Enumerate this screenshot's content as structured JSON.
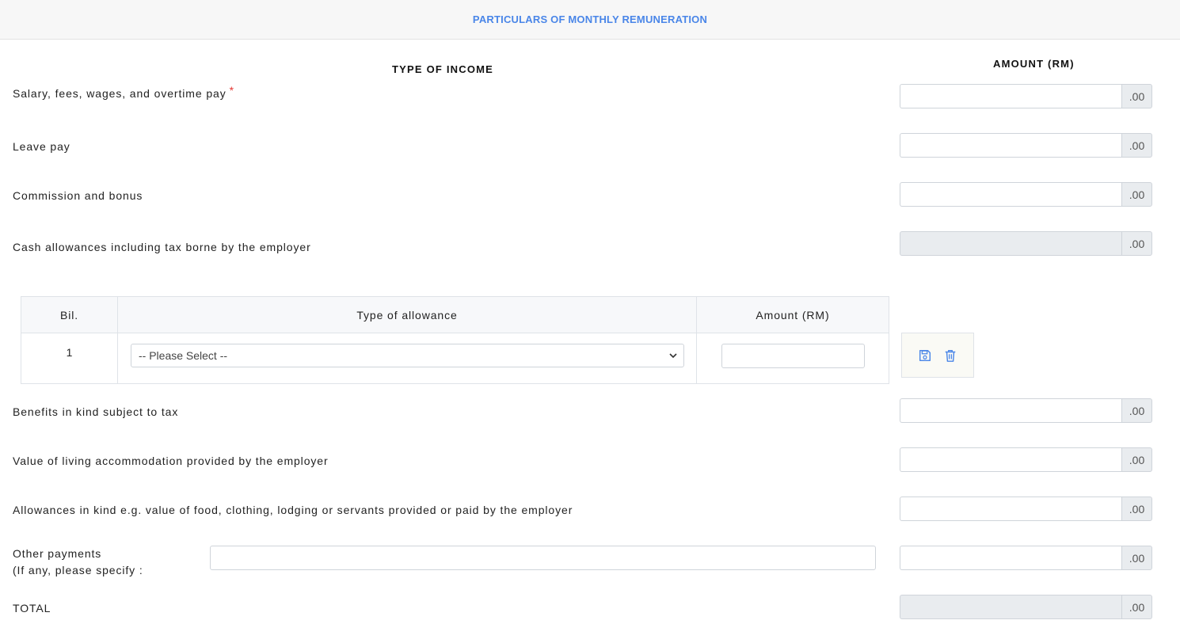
{
  "header": {
    "title": "PARTICULARS OF MONTHLY REMUNERATION"
  },
  "columns": {
    "type_of_income": "TYPE OF INCOME",
    "amount": "AMOUNT (RM)"
  },
  "rows": {
    "salary": {
      "label": "Salary, fees, wages, and overtime pay",
      "required_mark": "*",
      "value": "",
      "suffix": ".00"
    },
    "leave_pay": {
      "label": "Leave pay",
      "value": "",
      "suffix": ".00"
    },
    "commission": {
      "label": "Commission and bonus",
      "value": "",
      "suffix": ".00"
    },
    "cash_allowances": {
      "label": "Cash allowances including tax borne by the employer",
      "value": "",
      "suffix": ".00",
      "disabled": true
    },
    "benefits": {
      "label": "Benefits in kind subject to tax",
      "value": "",
      "suffix": ".00"
    },
    "living": {
      "label": "Value of living accommodation provided by the employer",
      "value": "",
      "suffix": ".00"
    },
    "allowances_kind": {
      "label": "Allowances in kind e.g. value of food, clothing, lodging or servants provided or paid by the employer",
      "value": "",
      "suffix": ".00"
    },
    "other": {
      "label_line1": "Other payments",
      "label_line2": "(If any, please specify :",
      "specify_value": "",
      "value": "",
      "suffix": ".00"
    },
    "total": {
      "label": "TOTAL",
      "value": "",
      "suffix": ".00",
      "disabled": true
    }
  },
  "allowance_table": {
    "headers": {
      "bil": "Bil.",
      "type": "Type of allowance",
      "amount": "Amount (RM)"
    },
    "rows": [
      {
        "bil": "1",
        "type_selected": "-- Please Select --",
        "amount": ""
      }
    ]
  },
  "icons": {
    "save": "floppy-disk-icon",
    "delete": "trash-icon",
    "chevron": "chevron-down-icon"
  },
  "colors": {
    "accent": "#4a86e8",
    "required": "#e53935",
    "icon": "#4a86e8"
  }
}
